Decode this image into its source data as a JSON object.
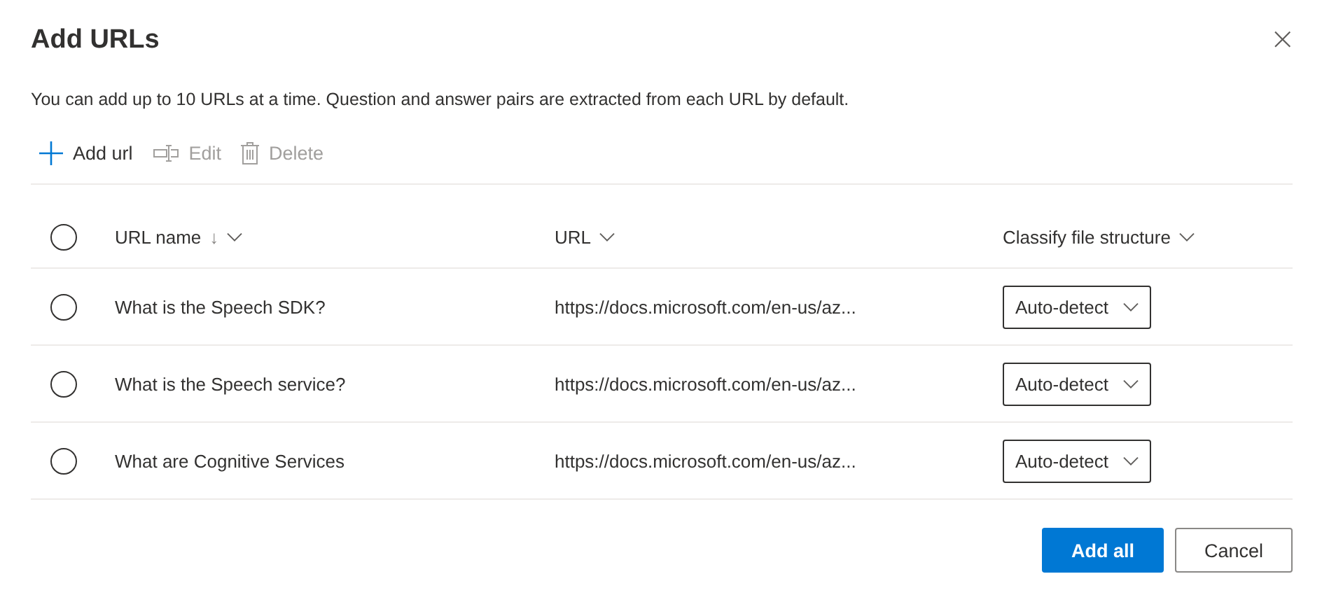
{
  "dialog": {
    "title": "Add URLs",
    "close_label": "×",
    "description": "You can add up to 10 URLs at a time. Question and answer pairs are extracted from each URL by default."
  },
  "toolbar": [
    {
      "kind": "add",
      "label": "Add url",
      "disabled": false
    },
    {
      "kind": "edit",
      "label": "Edit",
      "disabled": true
    },
    {
      "kind": "delete",
      "label": "Delete",
      "disabled": true
    }
  ],
  "table": {
    "select_all": {
      "selected": false
    },
    "columns": [
      {
        "label": "URL name",
        "sort": "↓"
      },
      {
        "label": "URL"
      },
      {
        "label": "Classify file structure"
      }
    ],
    "rows": [
      {
        "selected": false,
        "name": "What is the Speech SDK?",
        "url": "https://docs.microsoft.com/en-us/az...",
        "structure": "Auto-detect"
      },
      {
        "selected": false,
        "name": "What is the Speech service?",
        "url": "https://docs.microsoft.com/en-us/az...",
        "structure": "Auto-detect"
      },
      {
        "selected": false,
        "name": "What are Cognitive Services",
        "url": "https://docs.microsoft.com/en-us/az...",
        "structure": "Auto-detect"
      }
    ]
  },
  "buttons": [
    {
      "kind": "primary",
      "label": "Add all"
    },
    {
      "kind": "default",
      "label": "Cancel"
    }
  ]
}
